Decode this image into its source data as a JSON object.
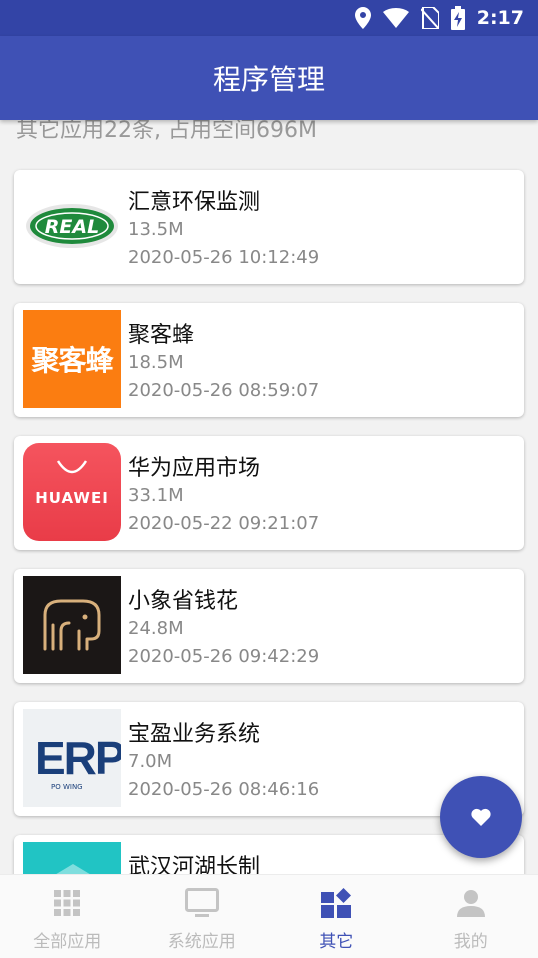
{
  "status_bar": {
    "time": "2:17"
  },
  "header": {
    "title": "程序管理"
  },
  "summary": "其它应用22条, 占用空间696M",
  "apps": [
    {
      "name": "汇意环保监测",
      "size": "13.5M",
      "date": "2020-05-26 10:12:49",
      "icon": "real-logo-icon",
      "icon_text": "REAL"
    },
    {
      "name": "聚客蜂",
      "size": "18.5M",
      "date": "2020-05-26 08:59:07",
      "icon": "jukefeng-logo-icon",
      "icon_text": "聚客蜂"
    },
    {
      "name": "华为应用市场",
      "size": "33.1M",
      "date": "2020-05-22 09:21:07",
      "icon": "huawei-appgallery-icon",
      "icon_text": "HUAWEI"
    },
    {
      "name": "小象省钱花",
      "size": "24.8M",
      "date": "2020-05-26 09:42:29",
      "icon": "elephant-logo-icon"
    },
    {
      "name": "宝盈业务系统",
      "size": "7.0M",
      "date": "2020-05-26 08:46:16",
      "icon": "erp-logo-icon",
      "icon_text": "ERP",
      "icon_subtext": "PO WING"
    },
    {
      "name": "武汉河湖长制",
      "size": "",
      "date": "",
      "icon": "river-lake-logo-icon"
    }
  ],
  "bottom_nav": [
    {
      "label": "全部应用",
      "icon": "grid-icon",
      "active": false
    },
    {
      "label": "系统应用",
      "icon": "monitor-icon",
      "active": false
    },
    {
      "label": "其它",
      "icon": "dashboard-icon",
      "active": true
    },
    {
      "label": "我的",
      "icon": "person-icon",
      "active": false
    }
  ],
  "colors": {
    "primary": "#3f51b5",
    "status_bar": "#3344a6",
    "inactive": "#bbbbbb"
  }
}
